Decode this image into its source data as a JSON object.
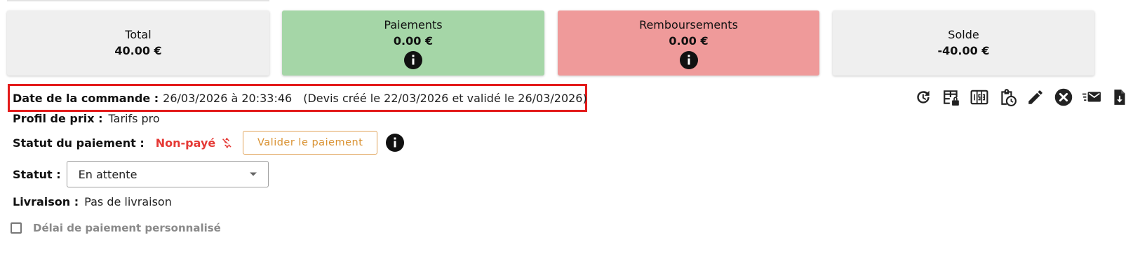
{
  "cards": {
    "total": {
      "title": "Total",
      "amount": "40.00 €"
    },
    "payments": {
      "title": "Paiements",
      "amount": "0.00 €",
      "color": "#a5d6a7"
    },
    "refunds": {
      "title": "Remboursements",
      "amount": "0.00 €",
      "color": "#ef9a9a"
    },
    "balance": {
      "title": "Solde",
      "amount": "-40.00 €"
    }
  },
  "order": {
    "date_label": "Date de la commande :",
    "date_value": "26/03/2026 à 20:33:46",
    "quote_note": "(Devis créé le 22/03/2026 et validé le 26/03/2026)"
  },
  "price_profile": {
    "label": "Profil de prix :",
    "value": "Tarifs pro"
  },
  "payment_status": {
    "label": "Statut du paiement :",
    "value": "Non-payé",
    "validate_button": "Valider le paiement",
    "status_color": "#e53935"
  },
  "status": {
    "label": "Statut :",
    "selected": "En attente"
  },
  "delivery": {
    "label": "Livraison :",
    "value": "Pas de livraison"
  },
  "custom_delay": {
    "label": "Délai de paiement personnalisé",
    "checked": false
  },
  "toolbar_icons": [
    "history-icon",
    "table-lock-icon",
    "numbers-icon",
    "clipboard-clock-icon",
    "pencil-icon",
    "close-circle-icon",
    "email-fast-icon",
    "file-download-icon"
  ],
  "accent_colors": {
    "highlight": "#e31b1b",
    "button_orange": "#d99130"
  }
}
